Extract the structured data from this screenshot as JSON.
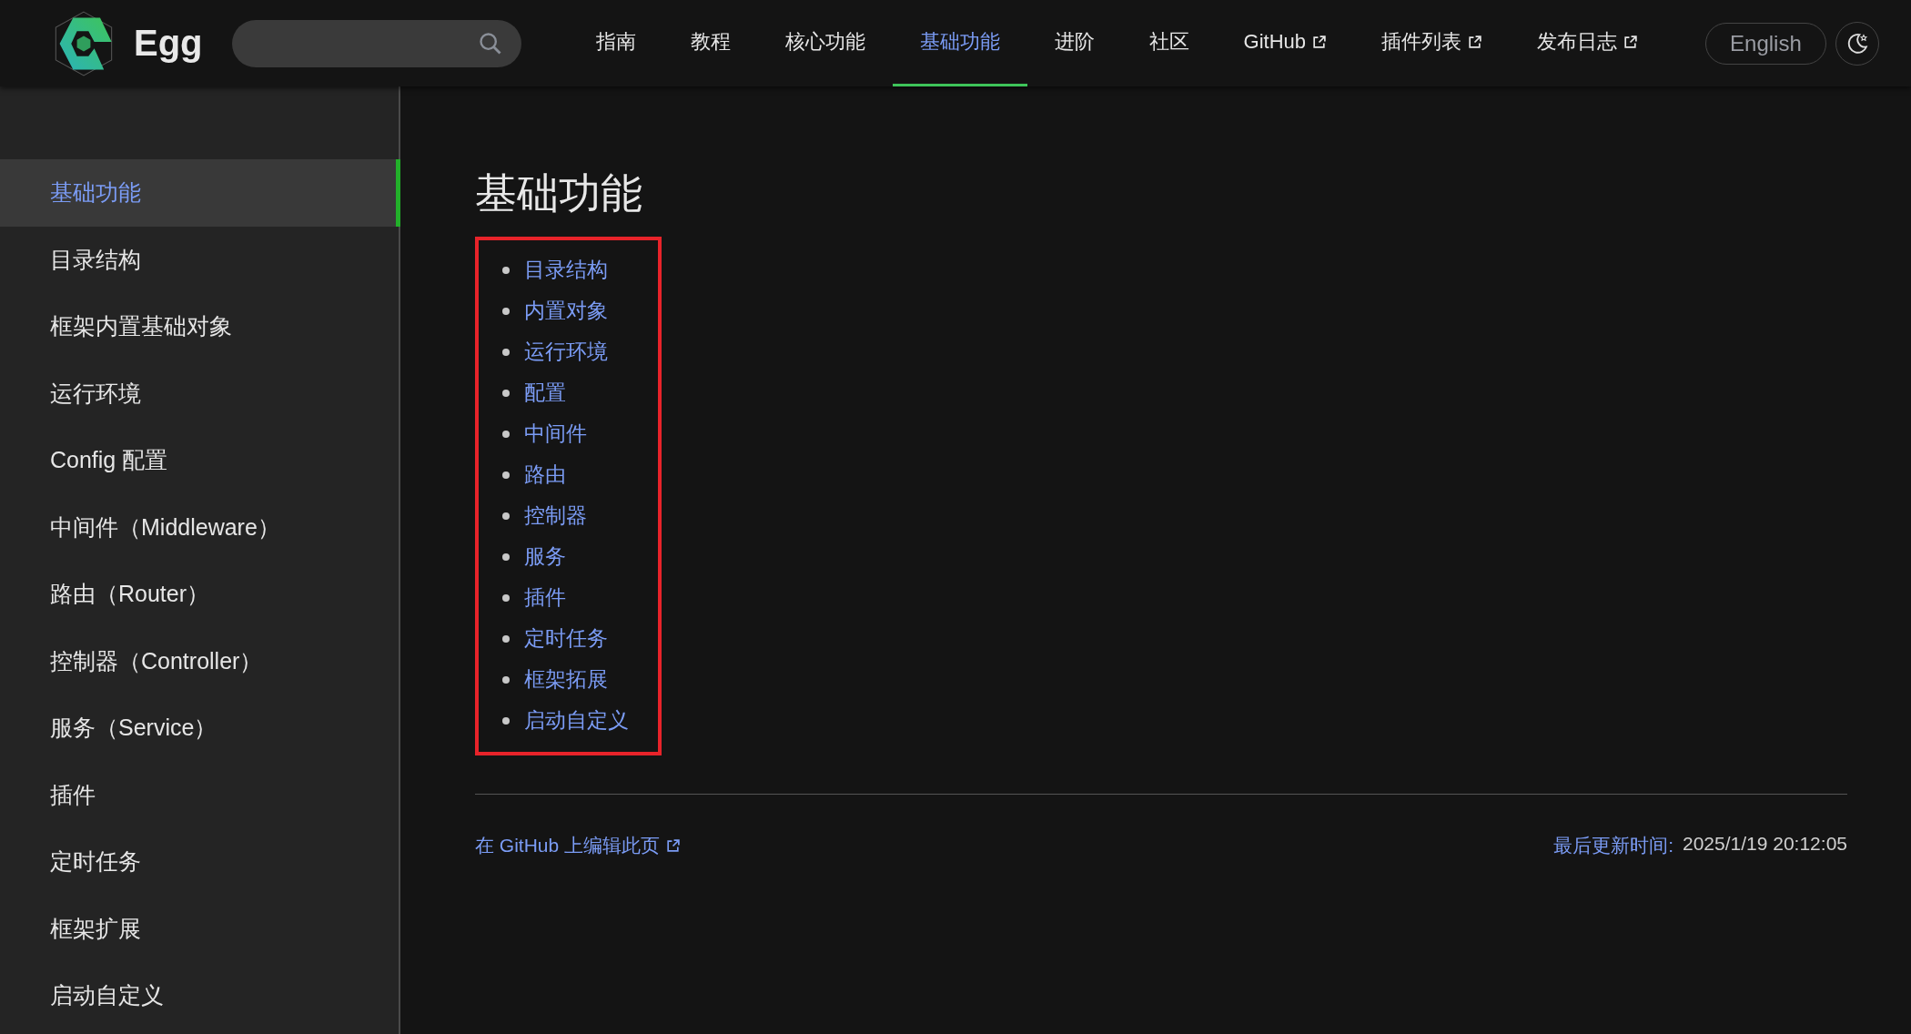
{
  "header": {
    "logo_text": "Egg",
    "nav": [
      {
        "label": "指南",
        "selected": false,
        "external": false
      },
      {
        "label": "教程",
        "selected": false,
        "external": false
      },
      {
        "label": "核心功能",
        "selected": false,
        "external": false
      },
      {
        "label": "基础功能",
        "selected": true,
        "external": false
      },
      {
        "label": "进阶",
        "selected": false,
        "external": false
      },
      {
        "label": "社区",
        "selected": false,
        "external": false
      },
      {
        "label": "GitHub",
        "selected": false,
        "external": true
      },
      {
        "label": "插件列表",
        "selected": false,
        "external": true
      },
      {
        "label": "发布日志",
        "selected": false,
        "external": true
      }
    ],
    "language_button": "English"
  },
  "sidebar": {
    "items": [
      {
        "label": "基础功能",
        "selected": true
      },
      {
        "label": "目录结构",
        "selected": false
      },
      {
        "label": "框架内置基础对象",
        "selected": false
      },
      {
        "label": "运行环境",
        "selected": false
      },
      {
        "label": "Config 配置",
        "selected": false
      },
      {
        "label": "中间件（Middleware）",
        "selected": false
      },
      {
        "label": "路由（Router）",
        "selected": false
      },
      {
        "label": "控制器（Controller）",
        "selected": false
      },
      {
        "label": "服务（Service）",
        "selected": false
      },
      {
        "label": "插件",
        "selected": false
      },
      {
        "label": "定时任务",
        "selected": false
      },
      {
        "label": "框架扩展",
        "selected": false
      },
      {
        "label": "启动自定义",
        "selected": false
      }
    ]
  },
  "content": {
    "title": "基础功能",
    "toc": {
      "highlighted": true,
      "items": [
        "目录结构",
        "内置对象",
        "运行环境",
        "配置",
        "中间件",
        "路由",
        "控制器",
        "服务",
        "插件",
        "定时任务",
        "框架拓展",
        "启动自定义"
      ]
    },
    "edit_link": "在 GitHub 上编辑此页",
    "last_updated_label": "最后更新时间:",
    "last_updated": "2025/1/19 20:12:05"
  }
}
